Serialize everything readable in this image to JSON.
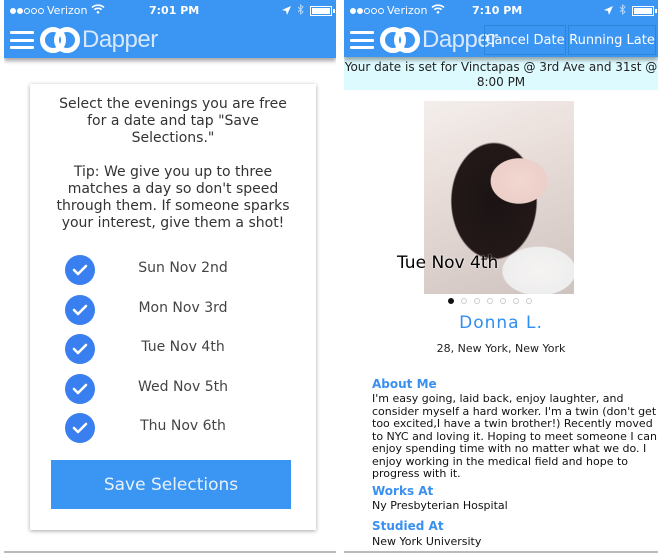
{
  "left_screen": {
    "status_bar": {
      "carrier": "Verizon",
      "signal_filled": 2,
      "signal_total": 5,
      "time": "7:01 PM"
    },
    "app_name": "Dapper",
    "intro_text": "Select the evenings you are free for a date and tap \"Save Selections.\"",
    "tip_text": "Tip: We give you up to three matches a day so don't speed through them. If someone sparks your interest, give them a shot!",
    "dates": [
      {
        "label": "Sun Nov 2nd",
        "checked": true
      },
      {
        "label": "Mon Nov 3rd",
        "checked": true
      },
      {
        "label": "Tue Nov 4th",
        "checked": true
      },
      {
        "label": "Wed Nov 5th",
        "checked": true
      },
      {
        "label": "Thu Nov 6th",
        "checked": true
      }
    ],
    "save_button": "Save Selections"
  },
  "right_screen": {
    "status_bar": {
      "carrier": "Verizon",
      "signal_filled": 2,
      "signal_total": 5,
      "time": "7:10 PM"
    },
    "app_name": "Dapper",
    "cancel_button": "Cancel Date",
    "late_button": "Running Late",
    "banner": "Your date is set for Vinctapas @ 3rd Ave and 31st @ 8:00 PM",
    "photo_caption": "Tue Nov 4th",
    "photo_count": 7,
    "photo_active_index": 0,
    "profile": {
      "name": "Donna L.",
      "details": "28, New York, New York",
      "about_heading": "About Me",
      "about_text": "I'm easy going, laid back, enjoy laughter, and consider myself a hard worker. I'm a twin (don't get too excited,I have a twin brother!) Recently moved to NYC and loving it. Hoping to meet someone I can enjoy spending time with no matter what we do. I enjoy working in the medical field and hope to progress with it.",
      "works_heading": "Works At",
      "works_value": "Ny Presbyterian Hospital",
      "studied_heading": "Studied At",
      "studied_value": "New York University"
    }
  },
  "colors": {
    "brand_blue": "#3b95f3",
    "check_blue": "#3a7ff0",
    "banner_bg": "#ddfafe",
    "accent_text": "#3a90f0"
  }
}
